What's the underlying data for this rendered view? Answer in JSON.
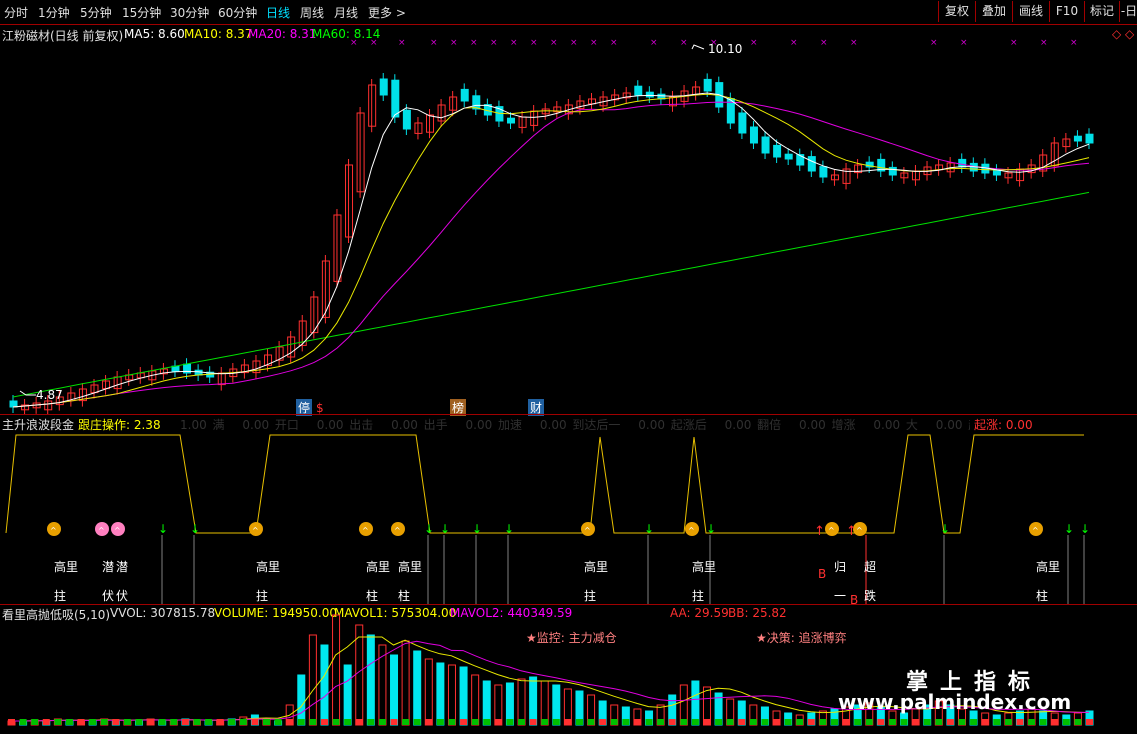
{
  "toolbar": {
    "periods": [
      "分时",
      "1分钟",
      "5分钟",
      "15分钟",
      "30分钟",
      "60分钟",
      "日线",
      "周线",
      "月线",
      "更多 >"
    ],
    "active": "日线",
    "right_buttons": [
      "复权",
      "叠加",
      "画线",
      "F10",
      "标记",
      "-日"
    ]
  },
  "main_pane": {
    "title": "江粉磁材(日线 前复权)",
    "ma5": "MA5: 8.60",
    "ma10": "MA10: 8.37",
    "ma20": "MA20: 8.31",
    "ma60": "MA60: 8.14",
    "high_label": "10.10",
    "low_label": "4.87",
    "event_labels": [
      "停",
      "$",
      "榜",
      "财"
    ],
    "colors": {
      "up": "#ff3030",
      "down": "#00e0e8",
      "ma5": "#ffffff",
      "ma10": "#ffff00",
      "ma20": "#ff00ff",
      "ma60": "#00ff00"
    }
  },
  "wave_pane": {
    "title": "主升浪波段金",
    "op": "跟庄操作: 2.38",
    "faded_labels": [
      "1.00",
      "满",
      "0.00",
      "开口",
      "0.00",
      "出击",
      "0.00",
      "出手",
      "0.00",
      "加速",
      "0.00",
      "到达后一",
      "0.00",
      "起涨后",
      "0.00",
      "翻倍",
      "0.00",
      "增涨",
      "0.00",
      "大",
      "0.00",
      "起涨:"
    ],
    "qizhang": "起涨: 0.00",
    "signal_texts": [
      "高里",
      "拄",
      "潜",
      "伏",
      "潜",
      "伏",
      "高里",
      "拄",
      "高里",
      "柱",
      "高里",
      "柱",
      "高里",
      "拄",
      "高里",
      "拄",
      "归",
      "一",
      "超",
      "跌",
      "高里",
      "柱",
      "B",
      "B"
    ]
  },
  "vol_pane": {
    "title": "看里高抛低吸(5,10)",
    "vvol": "VVOL: 307815.78",
    "volume": "VOLUME: 194950.00",
    "mavol1": "MAVOL1: 575304.00",
    "mavol2": "MAVOL2: 440349.59",
    "aa": "AA: 29.59",
    "bb": "BB: 25.82",
    "monitor": "★监控:  主力减仓",
    "decision": "★决策:  追涨博弈"
  },
  "watermark": {
    "cn": "掌上指标",
    "url": "www.palmindex.com"
  }
}
